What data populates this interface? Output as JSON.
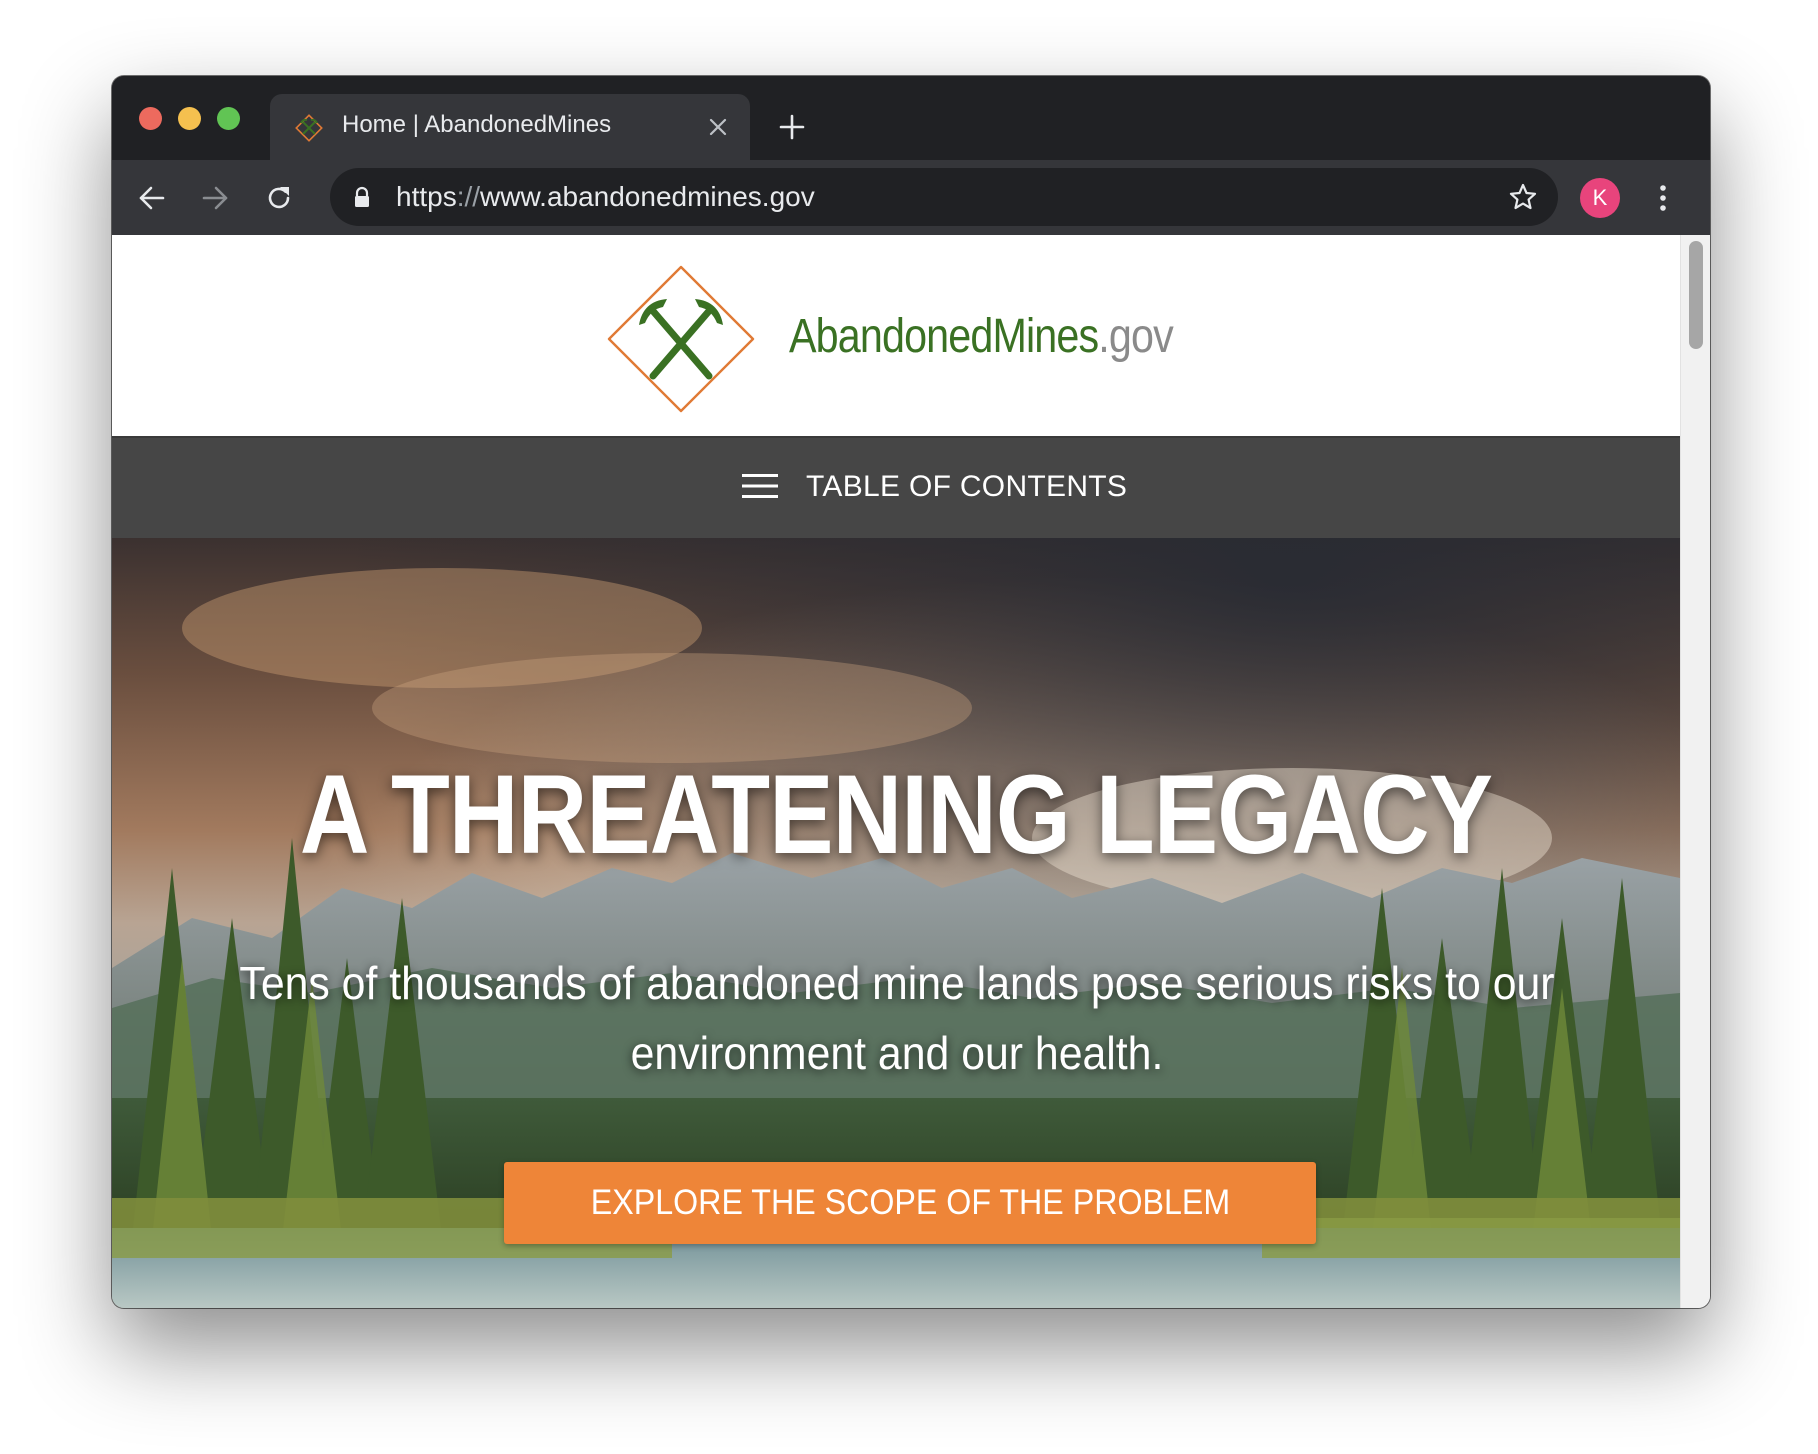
{
  "browser": {
    "tab": {
      "title": "Home | AbandonedMines"
    },
    "address_bar": {
      "scheme": "https",
      "separator": "://",
      "host": "www.abandonedmines.gov"
    },
    "profile_initial": "K"
  },
  "site": {
    "name_main": "AbandonedMines",
    "name_tld": ".gov",
    "nav": {
      "toc_label": "TABLE OF CONTENTS"
    },
    "hero": {
      "title": "A THREATENING LEGACY",
      "subtitle": "Tens of thousands of abandoned mine lands pose serious risks to our environment and our health.",
      "cta_label": "EXPLORE THE SCOPE OF THE PROBLEM"
    }
  },
  "colors": {
    "brand_green": "#3a7123",
    "brand_orange": "#ee8538",
    "nav_bar": "#464646",
    "tld_gray": "#8a8a8a",
    "avatar_pink": "#e8447c"
  },
  "icons": {
    "tab_favicon": "crossed-pickaxes-icon",
    "tab_close": "close-icon",
    "new_tab": "plus-icon",
    "back": "arrow-left-icon",
    "forward": "arrow-right-icon",
    "reload": "reload-icon",
    "lock": "lock-icon",
    "bookmark": "star-icon",
    "menu": "kebab-menu-icon",
    "toc": "hamburger-icon",
    "logo": "crossed-pickaxes-diamond-logo"
  }
}
